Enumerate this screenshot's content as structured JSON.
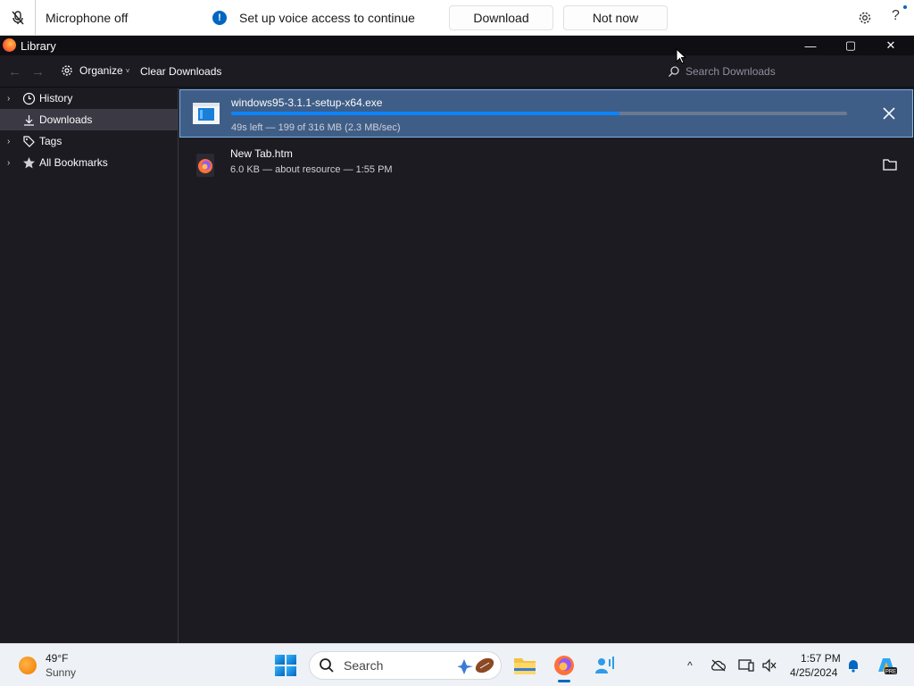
{
  "voice_bar": {
    "mic_label": "Microphone off",
    "setup_text": "Set up voice access to continue",
    "download_label": "Download",
    "not_now_label": "Not now",
    "help_glyph": "?",
    "info_glyph": "!"
  },
  "window": {
    "title": "Library",
    "minimize_glyph": "—",
    "maximize_glyph": "▢",
    "close_glyph": "✕"
  },
  "toolbar": {
    "back_glyph": "←",
    "forward_glyph": "→",
    "organize_label": "Organize",
    "organize_caret": "˅",
    "clear_label": "Clear Downloads",
    "search_placeholder": "Search Downloads"
  },
  "sidebar": {
    "items": [
      {
        "label": "History",
        "icon": "clock-icon",
        "twisty": "›"
      },
      {
        "label": "Downloads",
        "icon": "download-icon",
        "twisty": ""
      },
      {
        "label": "Tags",
        "icon": "tag-icon",
        "twisty": "›"
      },
      {
        "label": "All Bookmarks",
        "icon": "star-icon",
        "twisty": "›"
      }
    ],
    "selected": "Downloads"
  },
  "downloads": [
    {
      "name": "windows95-3.1.1-setup-x64.exe",
      "status": "49s left — 199 of 316 MB (2.3 MB/sec)",
      "progress": 0.63,
      "action": "cancel-icon",
      "icon": "exe-file-icon"
    },
    {
      "name": "New Tab.htm",
      "status": "6.0 KB — about resource — 1:55 PM",
      "action": "folder-icon",
      "icon": "firefox-file-icon"
    }
  ],
  "taskbar": {
    "weather_temp": "49°F",
    "weather_desc": "Sunny",
    "search_label": "Search",
    "time": "1:57 PM",
    "date": "4/25/2024",
    "tray_overflow_glyph": "^"
  },
  "colors": {
    "accent": "#0a84ff",
    "selection": "#3f5e87",
    "window_bg": "#1c1b22"
  }
}
